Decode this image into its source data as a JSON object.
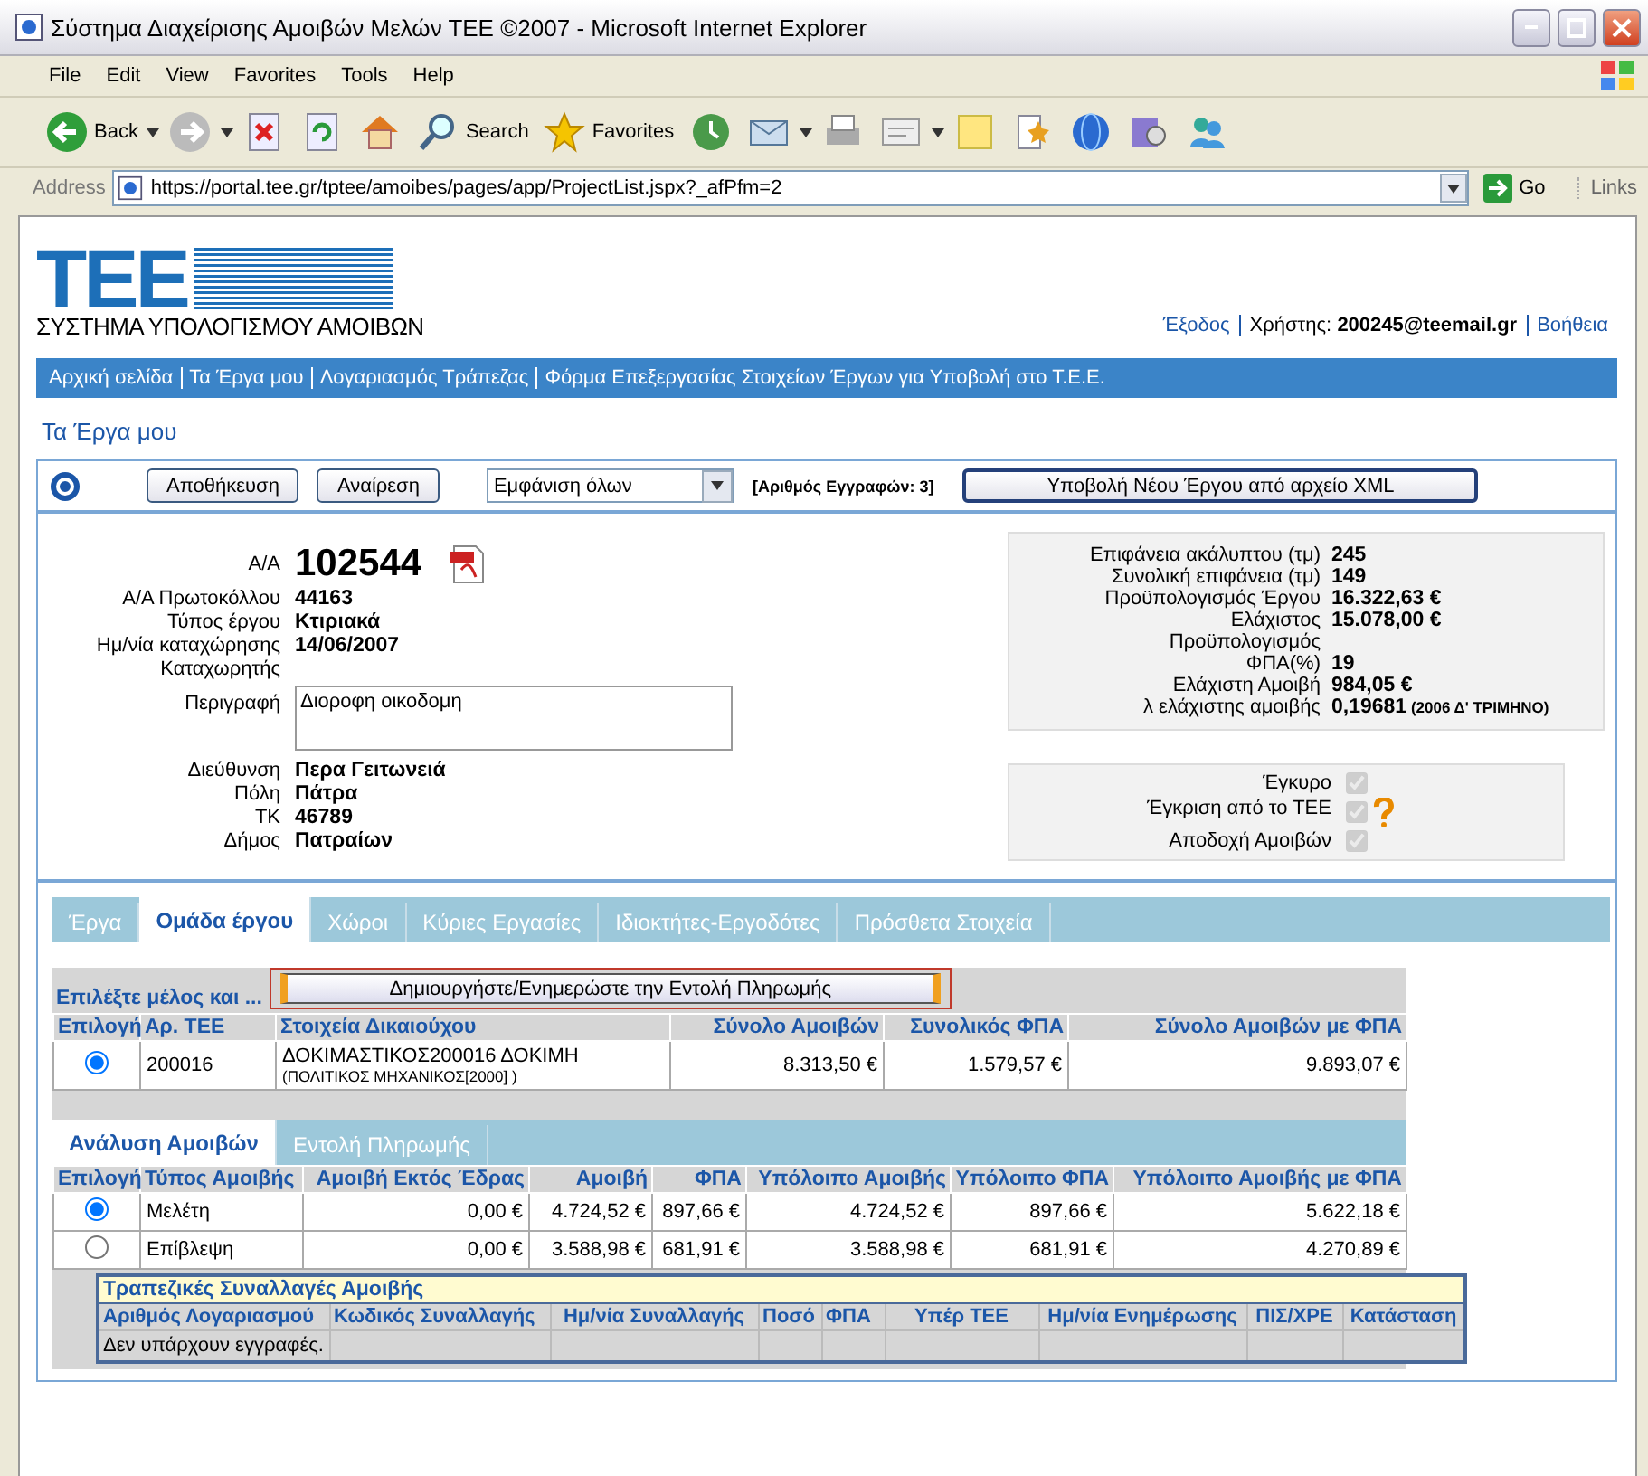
{
  "window": {
    "title": "Σύστημα Διαχείρισης Αμοιβών Μελών ΤΕΕ ©2007 - Microsoft Internet Explorer"
  },
  "menu": [
    "File",
    "Edit",
    "View",
    "Favorites",
    "Tools",
    "Help"
  ],
  "toolbar": [
    {
      "kind": "back",
      "label": "Back",
      "dropdown": true
    },
    {
      "kind": "forward",
      "dropdown": true
    },
    {
      "kind": "stop"
    },
    {
      "kind": "refresh"
    },
    {
      "kind": "home"
    },
    {
      "kind": "search",
      "label": "Search"
    },
    {
      "kind": "favorites",
      "label": "Favorites"
    },
    {
      "kind": "history"
    },
    {
      "kind": "mail",
      "dropdown": true
    },
    {
      "kind": "print"
    },
    {
      "kind": "edit",
      "dropdown": true
    },
    {
      "kind": "note"
    },
    {
      "kind": "research"
    },
    {
      "kind": "globe"
    },
    {
      "kind": "media"
    },
    {
      "kind": "messenger"
    }
  ],
  "address": {
    "label": "Address",
    "url": "https://portal.tee.gr/tptee/amoibes/pages/app/ProjectList.jspx?_afPfm=2",
    "go": "Go",
    "links": "Links"
  },
  "header": {
    "logo": "ΤΕΕ",
    "subtitle": "ΣΥΣΤΗΜΑ ΥΠΟΛΟΓΙΣΜΟΥ ΑΜΟΙΒΩΝ",
    "logout": "Έξοδος",
    "user_label": "Χρήστης:",
    "user": "200245@teemail.gr",
    "help": "Βοήθεια"
  },
  "nav": [
    "Αρχική σελίδα",
    "Τα Έργα μου",
    "Λογαριασμός Τράπεζας",
    "Φόρμα Επεξεργασίας Στοιχείων Έργων για Υποβολή στο Τ.Ε.Ε."
  ],
  "page_title": "Τα Έργα μου",
  "actions": {
    "save": "Αποθήκευση",
    "cancel": "Αναίρεση",
    "filter": "Εμφάνιση όλων",
    "count": "[Αριθμός Εγγραφών: 3]",
    "upload": "Υποβολή Νέου Έργου από αρχείο XML"
  },
  "project": [
    {
      "kind": "id",
      "label": "Α/Α",
      "value": "102544"
    },
    {
      "kind": "text",
      "label": "Α/Α Πρωτοκόλλου",
      "value": "44163"
    },
    {
      "kind": "text",
      "label": "Τύπος έργου",
      "value": "Κτιριακά"
    },
    {
      "kind": "text",
      "label": "Ημ/νία καταχώρησης",
      "value": "14/06/2007"
    },
    {
      "kind": "text",
      "label": "Καταχωρητής"
    },
    {
      "kind": "textarea",
      "label": "Περιγραφή",
      "value": "Διοροφη οικοδομη"
    },
    {
      "kind": "text",
      "label": "Διεύθυνση",
      "value": "Περα Γειτωνειά"
    },
    {
      "kind": "text",
      "label": "Πόλη",
      "value": "Πάτρα"
    },
    {
      "kind": "text",
      "label": "ΤΚ",
      "value": "46789"
    },
    {
      "kind": "text",
      "label": "Δήμος",
      "value": "Πατραίων"
    }
  ],
  "stats": [
    {
      "label": "Επιφάνεια ακάλυπτου (τμ)",
      "value": "245"
    },
    {
      "label": "Συνολική επιφάνεια (τμ)",
      "value": "149"
    },
    {
      "label": "Προϋπολογισμός Έργου",
      "value": "16.322,63 €"
    },
    {
      "label": "Ελάχιστος",
      "value": "15.078,00 €"
    },
    {
      "label": "Προϋπολογισμός"
    },
    {
      "label": "ΦΠΑ(%)",
      "value": "19"
    },
    {
      "label": "Ελάχιστη Αμοιβή",
      "value": "984,05 €"
    },
    {
      "label": "λ ελάχιστης αμοιβής",
      "value": "0,19681",
      "note": "(2006 Δ' ΤΡΙΜΗΝΟ)"
    }
  ],
  "flags": [
    {
      "label": "Έγκυρο",
      "checked": true,
      "help": false
    },
    {
      "label": "Έγκριση από το ΤΕΕ",
      "checked": true,
      "help": true
    },
    {
      "label": "Αποδοχή Αμοιβών",
      "checked": true,
      "help": false
    }
  ],
  "tabs": [
    {
      "label": "Έργα",
      "selected": false
    },
    {
      "label": "Ομάδα έργου",
      "selected": true
    },
    {
      "label": "Χώροι",
      "selected": false
    },
    {
      "label": "Κύριες Εργασίες",
      "selected": false
    },
    {
      "label": "Ιδιοκτήτες-Εργοδότες",
      "selected": false
    },
    {
      "label": "Πρόσθετα Στοιχεία",
      "selected": false
    }
  ],
  "members": {
    "prompt": "Επιλέξτε μέλος και ...",
    "action": "Δημιουργήστε/Ενημερώστε την Εντολή Πληρωμής",
    "columns": [
      "Επιλογή",
      "Αρ. ΤΕΕ",
      "Στοιχεία Δικαιούχου",
      "Σύνολο Αμοιβών",
      "Συνολικός ΦΠΑ",
      "Σύνολο Αμοιβών με ΦΠΑ"
    ],
    "rows": [
      {
        "selected": true,
        "tee": "200016",
        "name": "ΔΟΚΙΜΑΣΤΙΚΟΣ200016 ΔΟΚΙΜΗ",
        "specialty": "(ΠΟΛΙΤΙΚΟΣ ΜΗΧΑΝΙΚΟΣ[2000] )",
        "total": "8.313,50 €",
        "vat": "1.579,57 €",
        "total_vat": "9.893,07 €"
      }
    ]
  },
  "subtabs": [
    {
      "label": "Ανάλυση Αμοιβών",
      "selected": true
    },
    {
      "label": "Εντολή Πληρωμής",
      "selected": false
    }
  ],
  "fees": {
    "select_header": "Επιλογή",
    "columns": [
      "Τύπος Αμοιβής",
      "Αμοιβή Εκτός Έδρας",
      "Αμοιβή",
      "ΦΠΑ",
      "Υπόλοιπο Αμοιβής",
      "Υπόλοιπο ΦΠΑ",
      "Υπόλοιπο Αμοιβής με ΦΠΑ"
    ],
    "rows": [
      {
        "selected": true,
        "cells": [
          "Μελέτη",
          "0,00 €",
          "4.724,52 €",
          "897,66 €",
          "4.724,52 €",
          "897,66 €",
          "5.622,18 €"
        ]
      },
      {
        "selected": false,
        "cells": [
          "Επίβλεψη",
          "0,00 €",
          "3.588,98 €",
          "681,91 €",
          "3.588,98 €",
          "681,91 €",
          "4.270,89 €"
        ]
      }
    ]
  },
  "transactions": {
    "title": "Τραπεζικές Συναλλαγές Αμοιβής",
    "columns": [
      "Αριθμός Λογαριασμού",
      "Κωδικός Συναλλαγής",
      "Ημ/νία Συναλλαγής",
      "Ποσό",
      "ΦΠΑ",
      "Υπέρ ΤΕΕ",
      "Ημ/νία Ενημέρωσης",
      "ΠΙΣ/ΧΡΕ",
      "Κατάσταση"
    ],
    "empty": "Δεν υπάρχουν εγγραφές."
  }
}
